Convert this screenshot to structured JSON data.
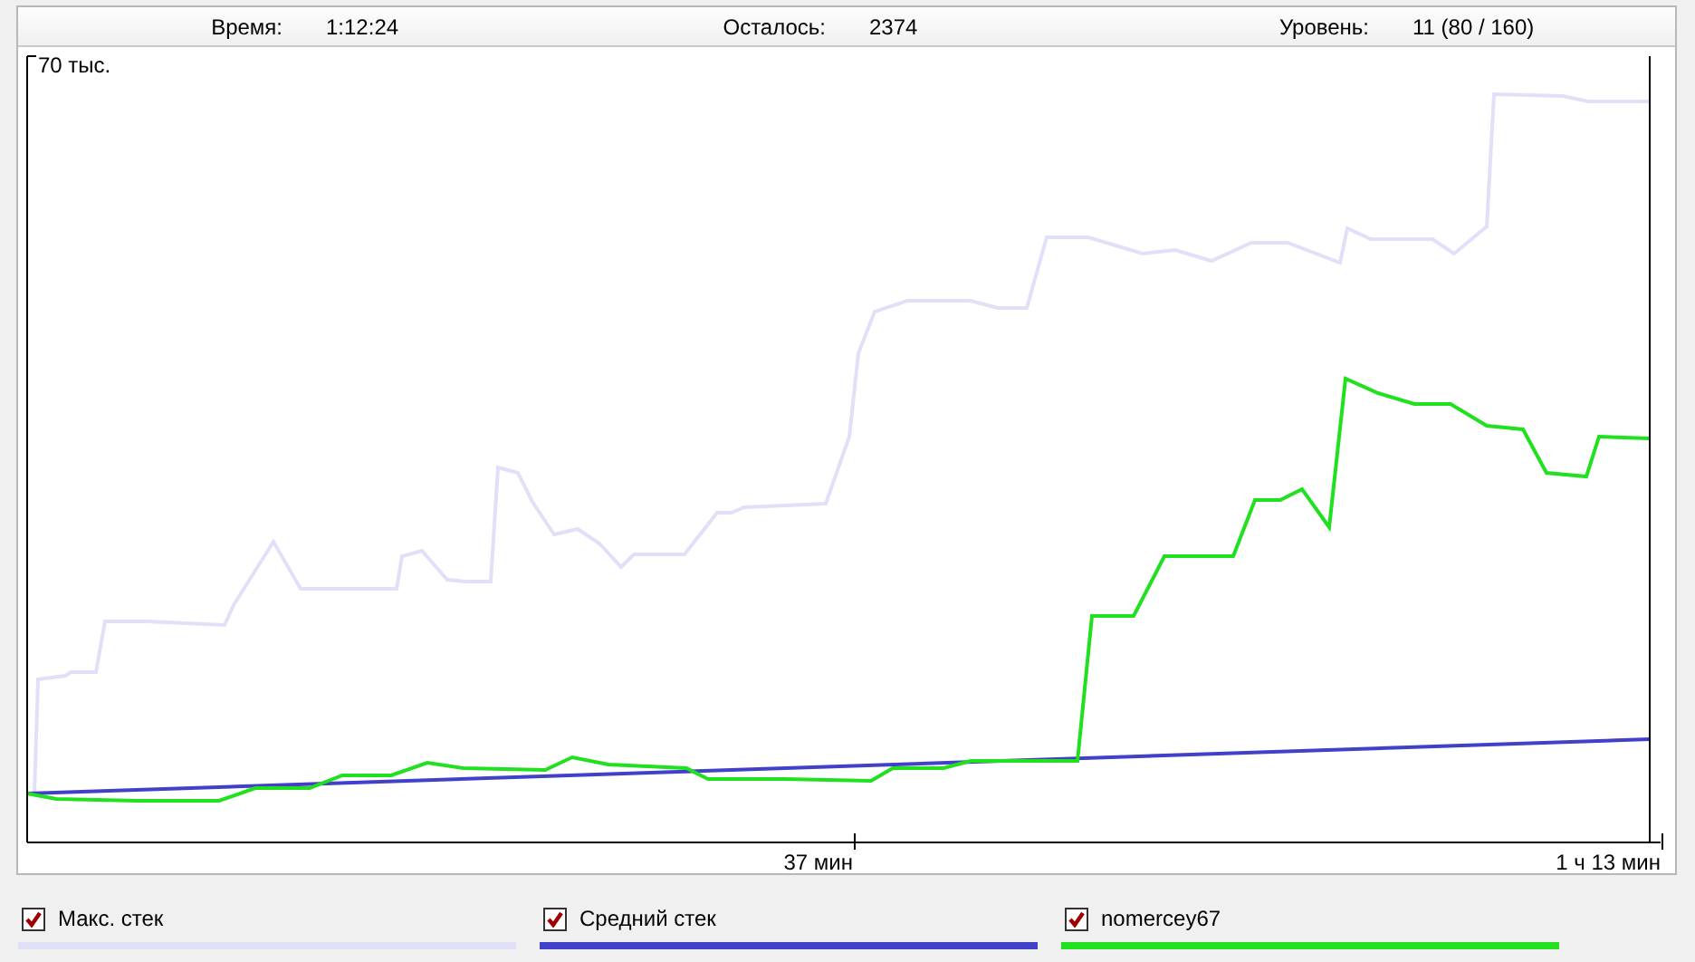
{
  "status_bar": [
    {
      "label": "Время:",
      "value": "1:12:24"
    },
    {
      "label": "Осталось:",
      "value": "2374"
    },
    {
      "label": "Уровень:",
      "value": "11 (80 / 160)"
    }
  ],
  "chart": {
    "y_label": "70 тыс.",
    "x_labels": [
      "37 мин",
      "1 ч 13 мин"
    ]
  },
  "legend": [
    {
      "label": "Макс. стек",
      "checked": true,
      "color": "#e0e0f8"
    },
    {
      "label": "Средний стек",
      "checked": true,
      "color": "#4040c8"
    },
    {
      "label": "nomercey67",
      "checked": true,
      "color": "#20e020"
    }
  ]
}
